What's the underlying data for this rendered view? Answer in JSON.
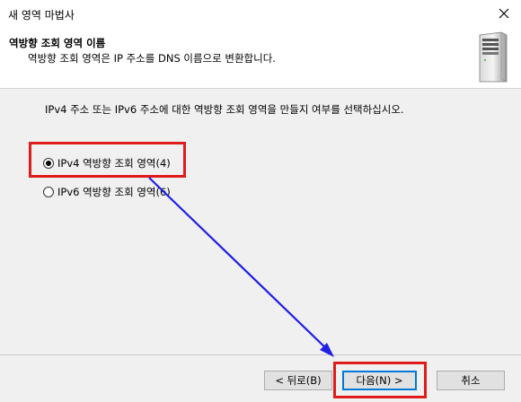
{
  "window": {
    "title": "새 영역 마법사"
  },
  "header": {
    "title": "역방향 조회 영역 이름",
    "subtitle": "역방향 조회 영역은 IP 주소를 DNS 이름으로 변환합니다."
  },
  "main": {
    "instruction": "IPv4 주소 또는 IPv6 주소에 대한 역방향 조회 영역을 만들지 여부를 선택하십시오.",
    "options": [
      {
        "label": "IPv4 역방향 조회 영역(4)",
        "checked": true
      },
      {
        "label": "IPv6 역방향 조회 영역(6)",
        "checked": false
      }
    ]
  },
  "buttons": {
    "back": "< 뒤로(B)",
    "next": "다음(N) >",
    "cancel": "취소"
  },
  "annotations": {
    "highlight_color": "#e01b1b",
    "arrow_color": "#1f1fe6"
  }
}
